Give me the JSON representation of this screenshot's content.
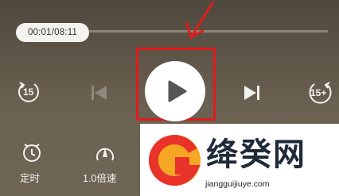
{
  "player": {
    "current_time": "00:01",
    "total_time": "08:11",
    "time_display": "00:01/08:11",
    "rewind_label": "15",
    "forward_label": "15+"
  },
  "bottom_bar": {
    "timer_label": "定时",
    "speed_label": "1.0倍速"
  },
  "watermark": {
    "title": "绛癸网",
    "url": "jiangguijiuye.com"
  },
  "colors": {
    "background": "#5e5649",
    "annotation": "#e01b1b",
    "play_button": "#ffffff"
  }
}
